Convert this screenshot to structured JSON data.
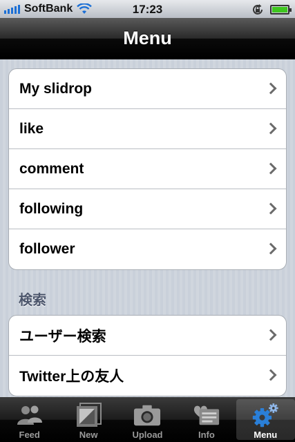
{
  "status_bar": {
    "carrier": "SoftBank",
    "time": "17:23"
  },
  "nav": {
    "title": "Menu"
  },
  "groups": [
    {
      "items": [
        {
          "label": "My slidrop"
        },
        {
          "label": "like"
        },
        {
          "label": "comment"
        },
        {
          "label": "following"
        },
        {
          "label": "follower"
        }
      ]
    },
    {
      "header": "検索",
      "items": [
        {
          "label": "ユーザー検索"
        },
        {
          "label": "Twitter上の友人"
        }
      ]
    }
  ],
  "tabs": [
    {
      "label": "Feed",
      "icon": "people-icon"
    },
    {
      "label": "New",
      "icon": "photo-frame-icon"
    },
    {
      "label": "Upload",
      "icon": "camera-icon"
    },
    {
      "label": "Info",
      "icon": "heart-message-icon"
    },
    {
      "label": "Menu",
      "icon": "gear-icon",
      "active": true
    }
  ],
  "colors": {
    "accent_blue": "#2a7fd8",
    "battery_green": "#3ec61f"
  }
}
